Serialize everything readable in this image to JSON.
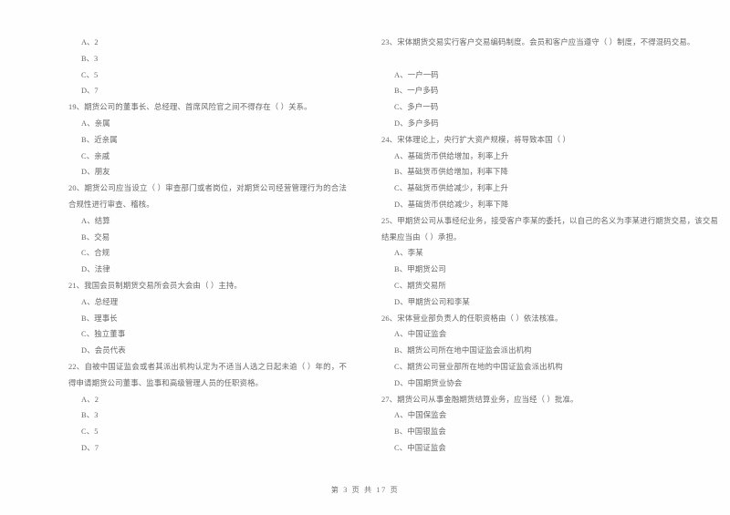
{
  "document": {
    "footer": "第 3 页 共 17 页"
  },
  "columns": {
    "left": [
      {
        "id": "q18-options-continued",
        "stem": "",
        "show_stem": false,
        "options": [
          "A、2",
          "B、3",
          "C、5",
          "D、7"
        ]
      },
      {
        "id": "q19",
        "stem": "19、期货公司的董事长、总经理、首席风险官之间不得存在（    ）关系。",
        "show_stem": true,
        "options": [
          "A、亲属",
          "B、近亲属",
          "C、亲戚",
          "D、朋友"
        ]
      },
      {
        "id": "q20",
        "stem": "20、期货公司应当设立（    ）审查部门或者岗位，对期货公司经营管理行为的合法合规性进行审查、稽核。",
        "show_stem": true,
        "options": [
          "A、结算",
          "B、交易",
          "C、合规",
          "D、法律"
        ]
      },
      {
        "id": "q21",
        "stem": "21、我国会员制期货交易所会员大会由（    ）主持。",
        "show_stem": true,
        "options": [
          "A、总经理",
          "B、理事长",
          "C、独立董事",
          "D、会员代表"
        ]
      },
      {
        "id": "q22",
        "stem": "22、自被中国证监会或者其派出机构认定为不适当人选之日起未逾（    ）年的，不得申请期货公司董事、监事和高级管理人员的任职资格。",
        "show_stem": true,
        "options": [
          "A、2",
          "B、3",
          "C、5",
          "D、7"
        ]
      }
    ],
    "right": [
      {
        "id": "q23",
        "stem": "23、宋体期货交易实行客户交易编码制度。会员和客户应当遵守（    ）制度，不得混码交易。",
        "show_stem": true,
        "blank_after_stem": true,
        "options": [
          "A、一户一码",
          "B、一户多码",
          "C、多户一码",
          "D、多户多码"
        ]
      },
      {
        "id": "q24",
        "stem": "24、宋体理论上，央行扩大资产规模，将导致本国（    ）",
        "show_stem": true,
        "blank_after_stem": false,
        "options": [
          "A、基础货币供给增加，利率上升",
          "B、基础货币供给增加，利率下降",
          "C、基础货币供给减少，利率上升",
          "D、基础货币供给减少，利率下降"
        ]
      },
      {
        "id": "q25",
        "stem": "25、甲期货公司从事经纪业务，接受客户李某的委托，以自己的名义为李某进行期货交易，该交易结果应当由（    ）承担。",
        "show_stem": true,
        "blank_after_stem": false,
        "options": [
          "A、李某",
          "B、甲期货公司",
          "C、期货交易所",
          "D、甲期货公司和李某"
        ]
      },
      {
        "id": "q26",
        "stem": "26、宋体营业部负责人的任职资格由（    ）依法核准。",
        "show_stem": true,
        "blank_after_stem": false,
        "options": [
          "A、中国证监会",
          "B、期货公司所在地中国证监会派出机构",
          "C、期货公司营业部所在地的中国证监会派出机构",
          "D、中国期货业协会"
        ]
      },
      {
        "id": "q27",
        "stem": "27、期货公司从事金融期货结算业务，应当经（    ）批准。",
        "show_stem": true,
        "blank_after_stem": false,
        "options": [
          "A、中国保监会",
          "B、中国银监会",
          "C、中国证监会"
        ]
      }
    ]
  }
}
